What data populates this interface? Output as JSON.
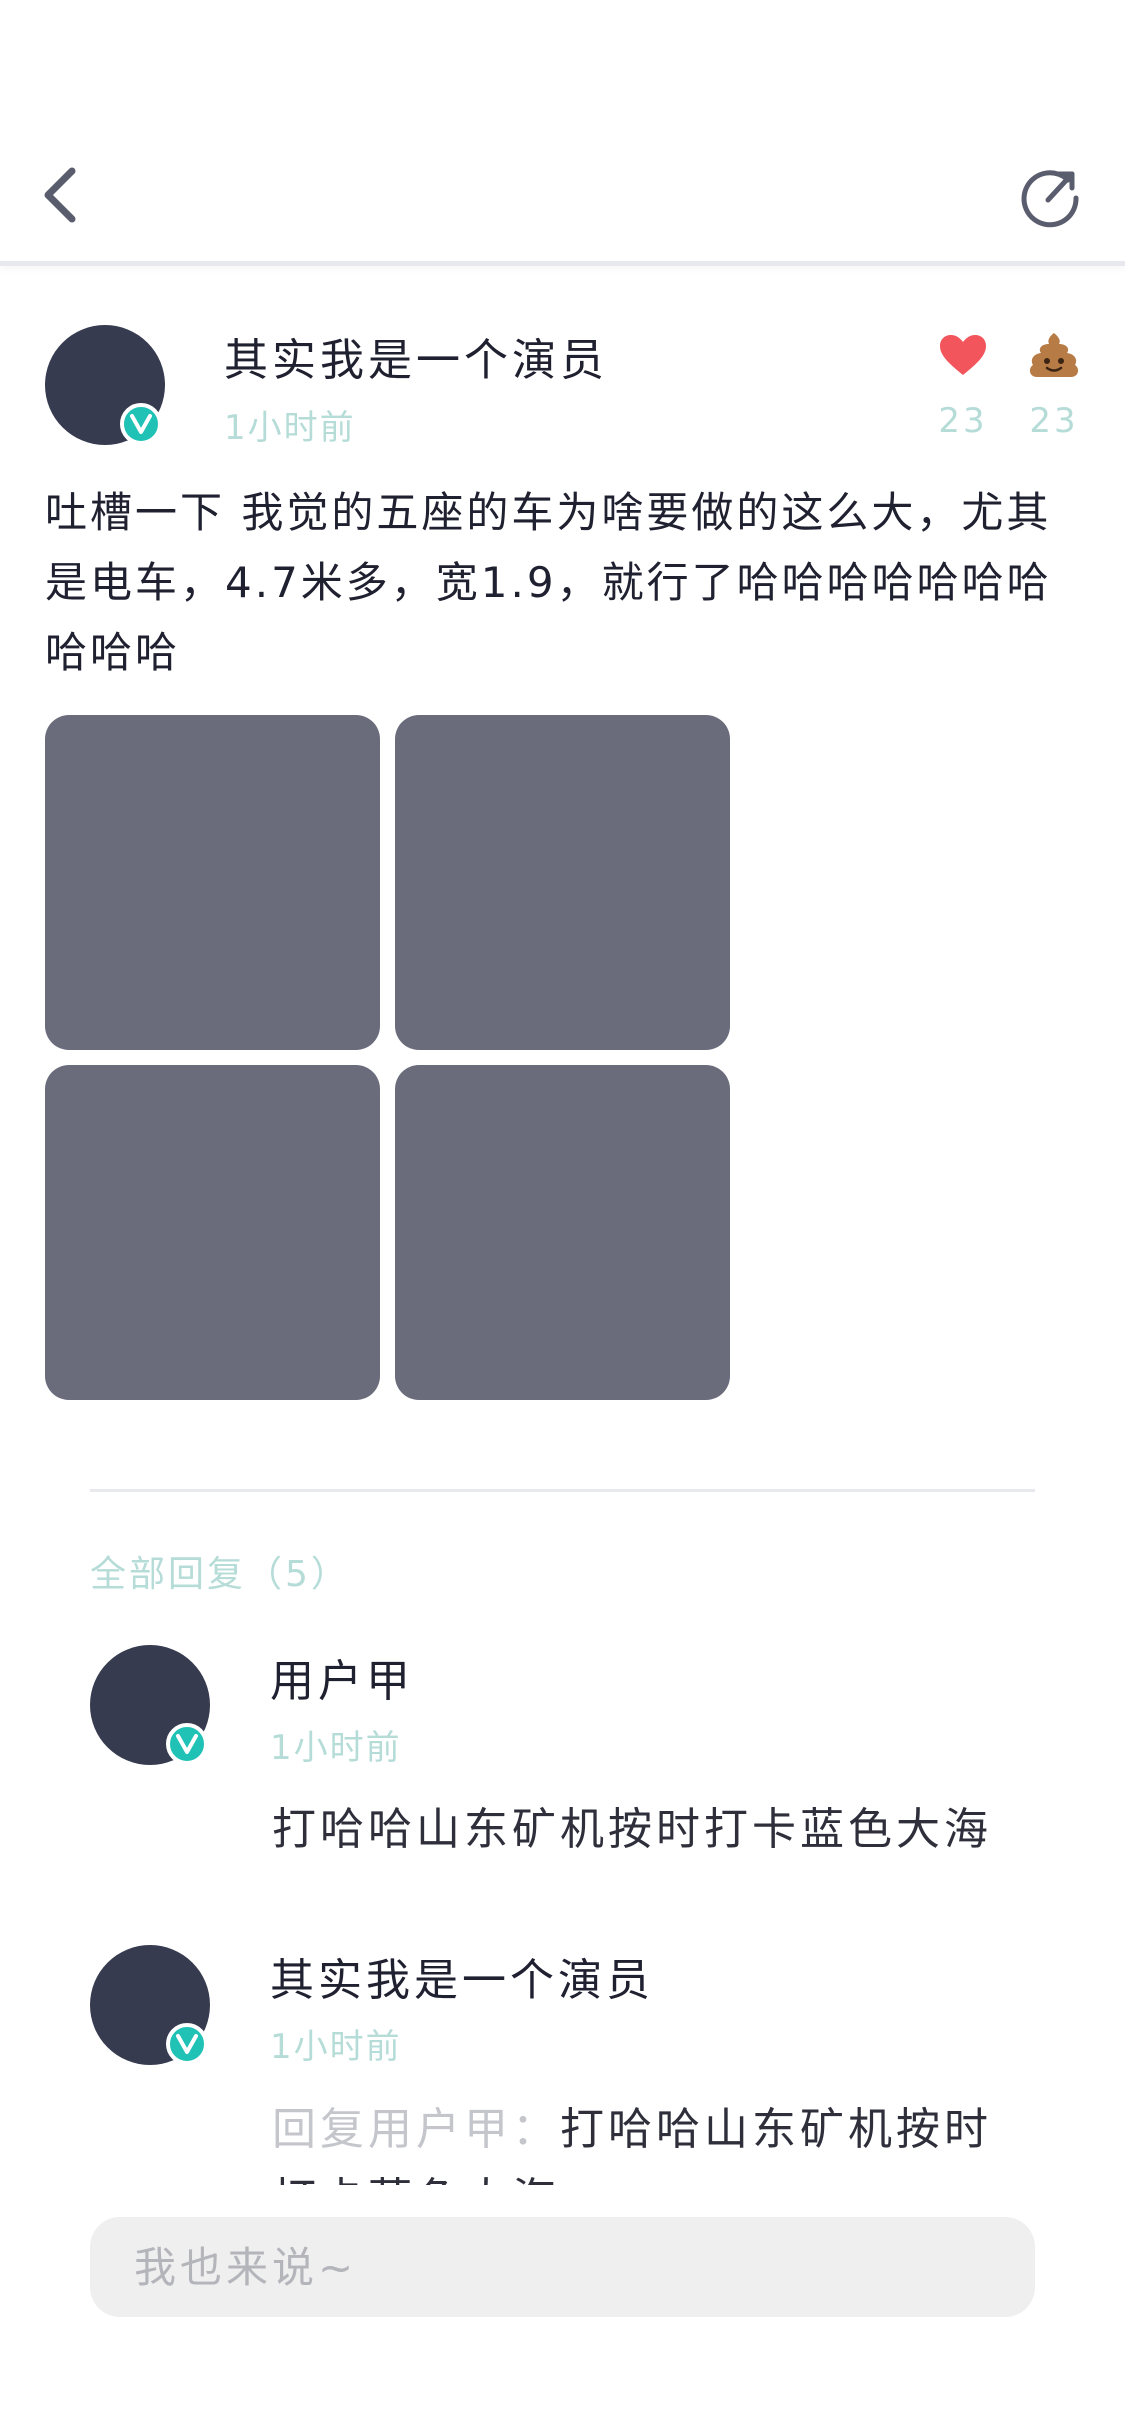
{
  "header": {
    "back_icon": "chevron-left-icon",
    "share_icon": "share-refresh-icon"
  },
  "post": {
    "author": "其实我是一个演员",
    "time": "1小时前",
    "verified_badge": "V",
    "likes": "23",
    "poops": "23",
    "like_icon": "heart-icon",
    "poop_icon": "poop-icon",
    "text": "吐槽一下 我觉的五座的车为啥要做的这么大，尤其是电车，4.7米多，宽1.9，就行了哈哈哈哈哈哈哈哈哈哈",
    "images": [
      "image-1",
      "image-2",
      "image-3",
      "image-4"
    ]
  },
  "replies": {
    "title": "全部回复（5）",
    "items": [
      {
        "author": "用户甲",
        "time": "1小时前",
        "text": "打哈哈山东矿机按时打卡蓝色大海"
      },
      {
        "author": "其实我是一个演员",
        "time": "1小时前",
        "reply_to": "回复用户甲：",
        "text": "打哈哈山东矿机按时打卡蓝色大海"
      }
    ]
  },
  "composer": {
    "placeholder": "我也来说~"
  },
  "colors": {
    "accent_teal": "#1fc2b5",
    "muted_teal_text": "#b6dcd8",
    "heart_red": "#f2555c",
    "avatar_dark": "#373b4f",
    "image_placeholder": "#6a6c7c"
  }
}
